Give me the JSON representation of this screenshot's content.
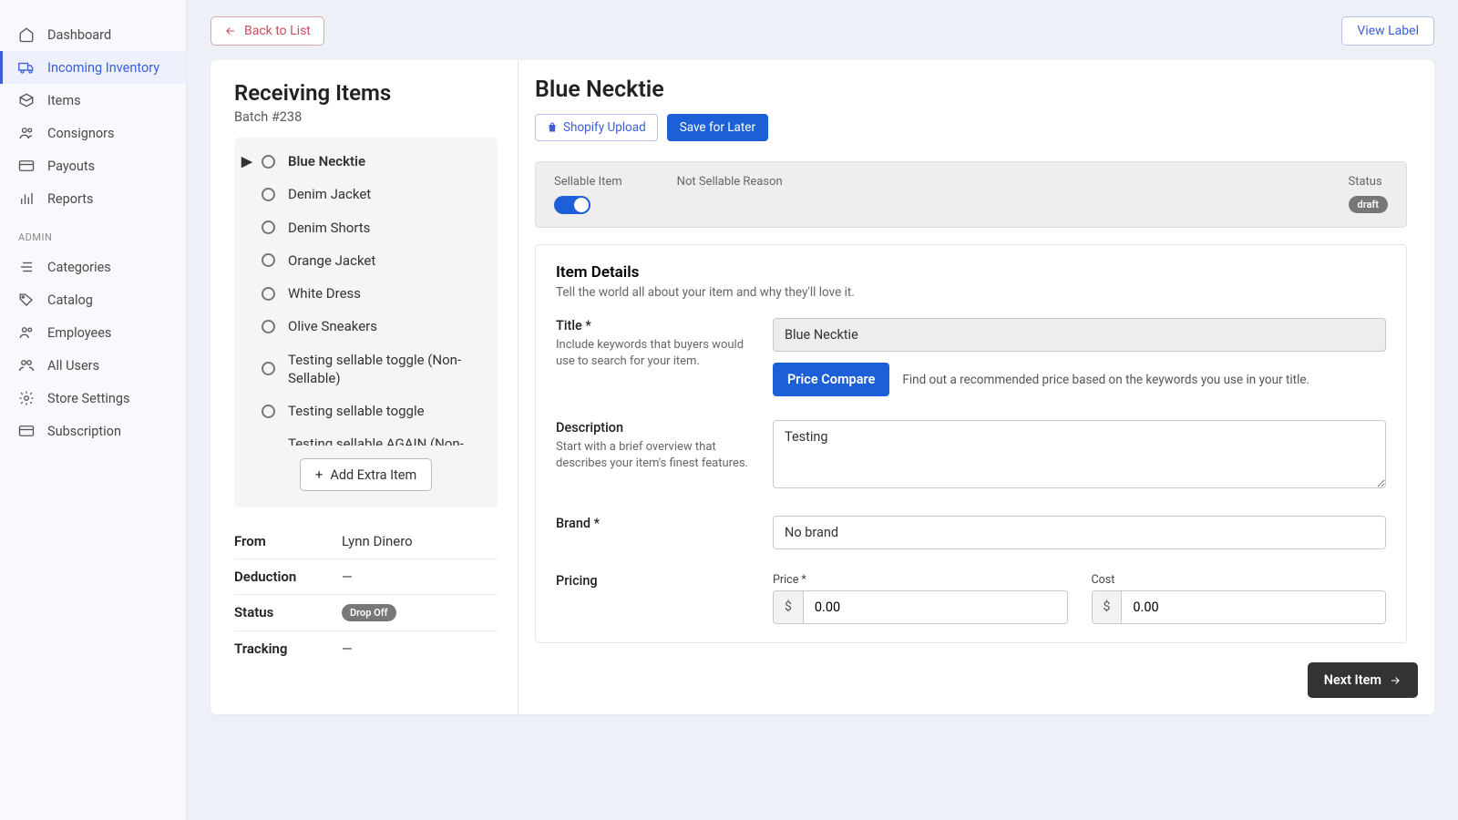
{
  "sidebar": {
    "items": [
      {
        "label": "Dashboard"
      },
      {
        "label": "Incoming Inventory"
      },
      {
        "label": "Items"
      },
      {
        "label": "Consignors"
      },
      {
        "label": "Payouts"
      },
      {
        "label": "Reports"
      }
    ],
    "admin_label": "ADMIN",
    "admin_items": [
      {
        "label": "Categories"
      },
      {
        "label": "Catalog"
      },
      {
        "label": "Employees"
      },
      {
        "label": "All Users"
      },
      {
        "label": "Store Settings"
      },
      {
        "label": "Subscription"
      }
    ]
  },
  "topbar": {
    "back_label": "Back to List",
    "view_label": "View Label"
  },
  "left_panel": {
    "title": "Receiving Items",
    "batch": "Batch #238",
    "add_extra": "Add Extra Item",
    "items": [
      "Blue Necktie",
      "Denim Jacket",
      "Denim Shorts",
      "Orange Jacket",
      "White Dress",
      "Olive Sneakers",
      "Testing sellable toggle (Non-Sellable)",
      "Testing sellable toggle",
      "Testing sellable AGAIN (Non-Sellable)"
    ],
    "meta": {
      "from_label": "From",
      "from_value": "Lynn Dinero",
      "deduction_label": "Deduction",
      "deduction_value": "—",
      "status_label": "Status",
      "status_value": "Drop Off",
      "tracking_label": "Tracking",
      "tracking_value": "—"
    }
  },
  "right_panel": {
    "title": "Blue Necktie",
    "shopify_label": "Shopify Upload",
    "save_label": "Save for Later",
    "status_bar": {
      "sellable_label": "Sellable Item",
      "reason_label": "Not Sellable Reason",
      "status_label": "Status",
      "status_value": "draft"
    },
    "details": {
      "title": "Item Details",
      "subtitle": "Tell the world all about your item and why they'll love it.",
      "title_field": {
        "label": "Title *",
        "help": "Include keywords that buyers would use to search for your item.",
        "value": "Blue Necktie"
      },
      "price_compare_btn": "Price Compare",
      "price_compare_help": "Find out a recommended price based on the keywords you use in your title.",
      "description": {
        "label": "Description",
        "help": "Start with a brief overview that describes your item's finest features.",
        "value": "Testing"
      },
      "brand": {
        "label": "Brand *",
        "value": "No brand"
      },
      "pricing": {
        "label": "Pricing",
        "price_label": "Price *",
        "price_value": "0.00",
        "cost_label": "Cost",
        "cost_value": "0.00",
        "currency": "$"
      }
    },
    "next_label": "Next Item"
  }
}
